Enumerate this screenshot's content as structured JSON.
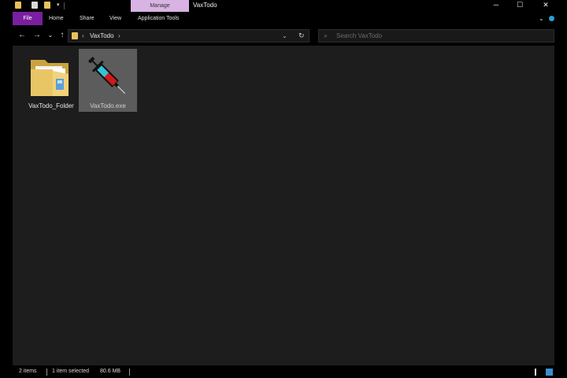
{
  "titlebar": {
    "manage_tab": "Manage",
    "window_title": "VaxTodo",
    "qa_dropdown": "▾",
    "controls": {
      "minimize": "─",
      "maximize": "☐",
      "close": "✕"
    }
  },
  "ribbon": {
    "file": "File",
    "tabs": [
      "Home",
      "Share",
      "View",
      "Application Tools"
    ],
    "collapse": "⌄"
  },
  "nav": {
    "back": "←",
    "forward": "→",
    "recent": "⌄",
    "up": "↑",
    "breadcrumb": [
      "VaxTodo"
    ],
    "crumb_separator": "›",
    "address_dropdown": "⌄",
    "refresh": "↻"
  },
  "search": {
    "placeholder": "Search VaxTodo",
    "icon": "⌕"
  },
  "files": [
    {
      "name": "VaxTodo_Folder",
      "icon": "folder-icon",
      "selected": false
    },
    {
      "name": "VaxTodo.exe",
      "icon": "syringe-icon",
      "selected": true
    }
  ],
  "status": {
    "item_count": "2 items",
    "selection": "1 item selected",
    "size": "80.6 MB"
  },
  "colors": {
    "file_tab": "#7a1fa0",
    "manage_tab": "#d8b3e3",
    "content_bg": "#1d1d1d",
    "selection": "#5c5c5c",
    "accent": "#3a8fd0"
  }
}
